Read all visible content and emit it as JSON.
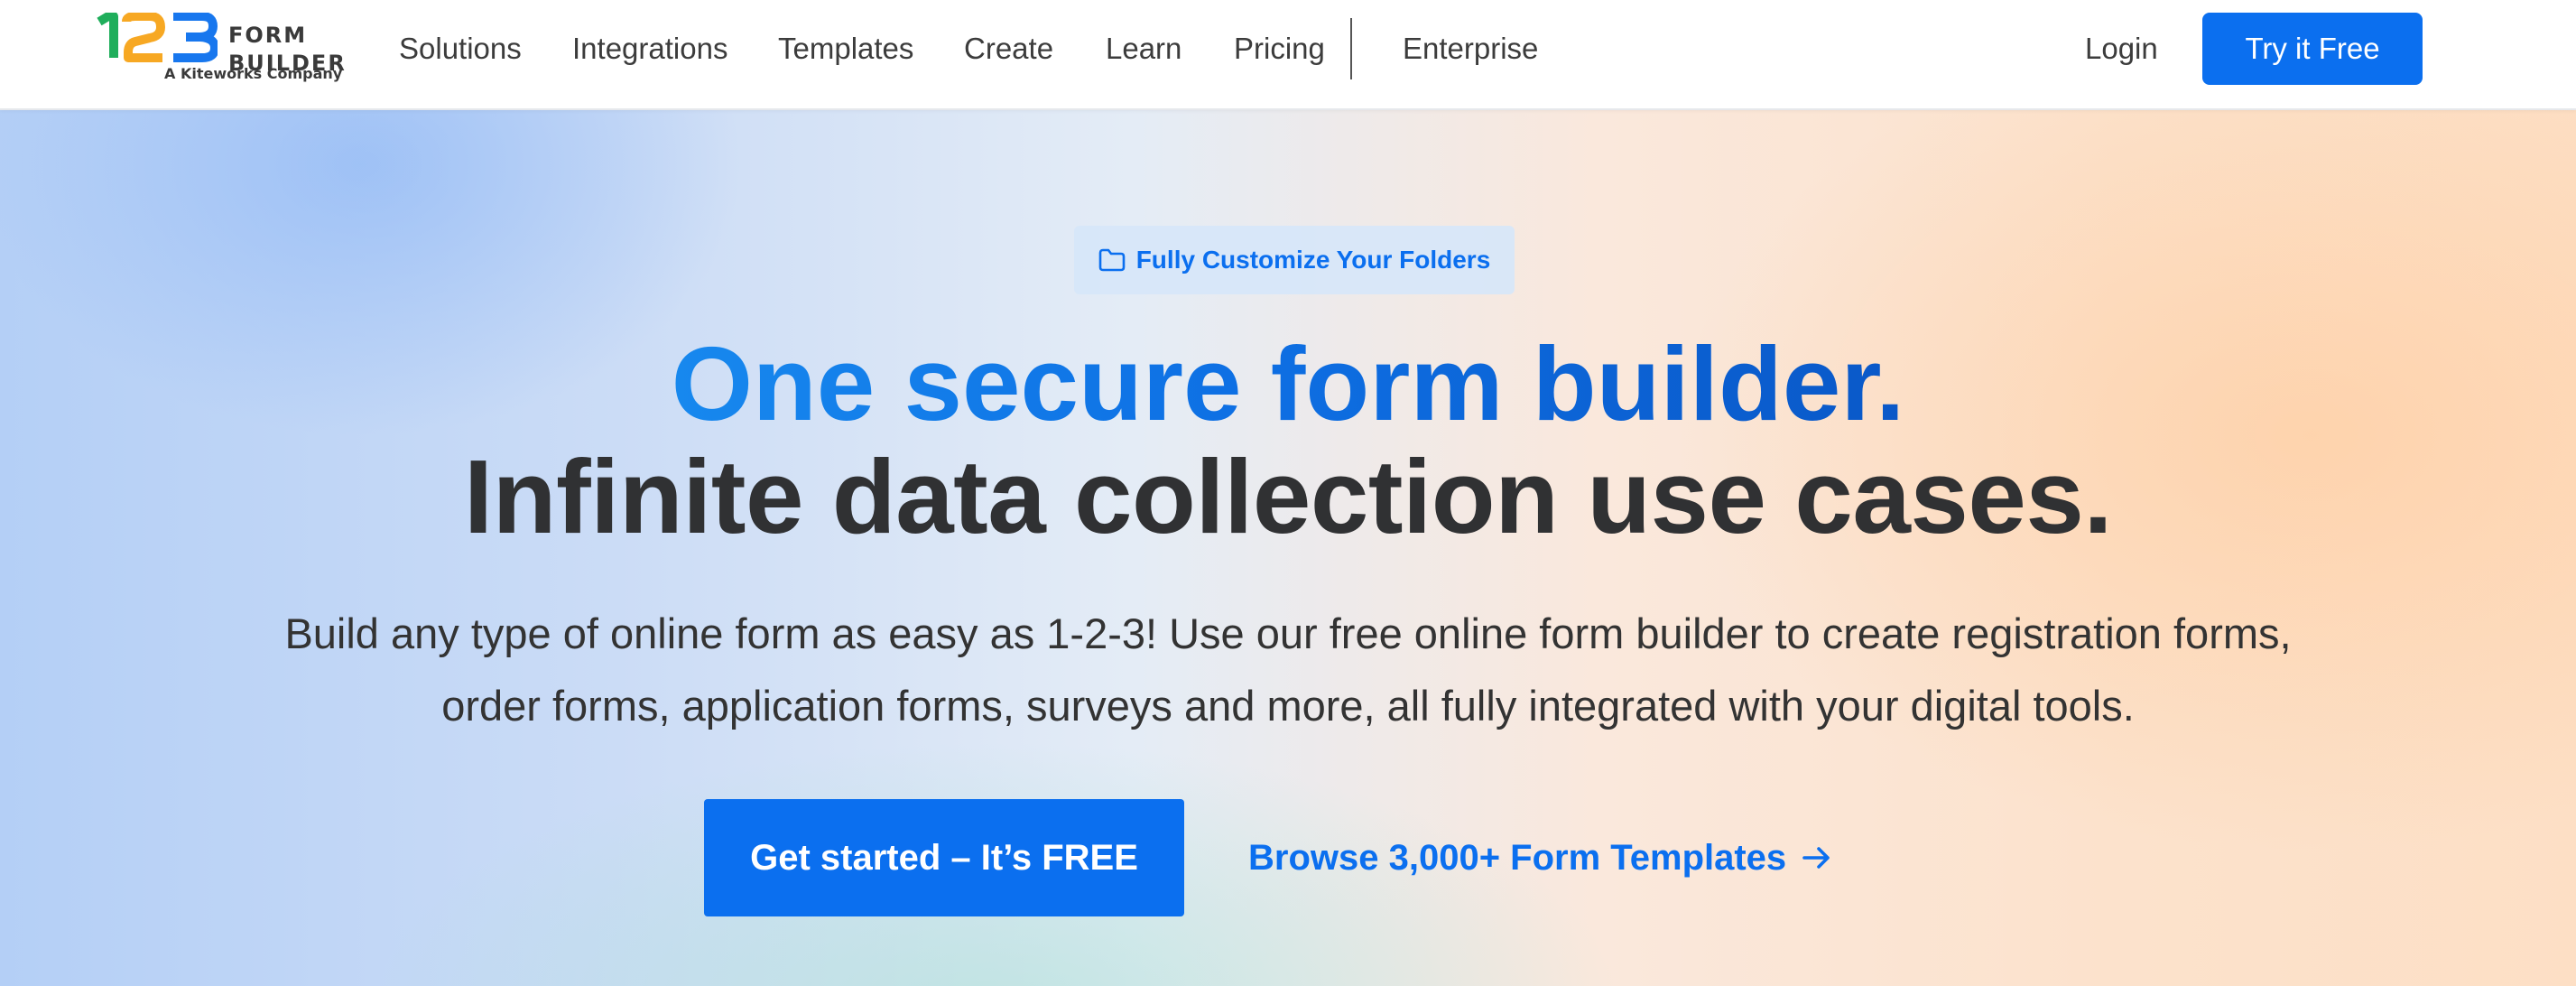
{
  "nav": {
    "logo": {
      "mark_text": "123",
      "word_line1": "FORM",
      "word_line2": "BUILDER",
      "tagline": "A Kiteworks Company"
    },
    "items": [
      {
        "label": "Solutions"
      },
      {
        "label": "Integrations"
      },
      {
        "label": "Templates"
      },
      {
        "label": "Create"
      },
      {
        "label": "Learn"
      },
      {
        "label": "Pricing"
      },
      {
        "label": "Enterprise"
      }
    ],
    "login_label": "Login",
    "try_free_label": "Try it Free"
  },
  "hero": {
    "badge": {
      "icon": "folder-icon",
      "label": "Fully Customize Your Folders"
    },
    "headline_line1": "One secure form builder.",
    "headline_line2": "Infinite data collection use cases.",
    "subtext_line1": "Build any type of online form as easy as 1-2-3! Use our free online form builder to create registration forms,",
    "subtext_line2": "order forms, application forms, surveys and more, all fully integrated with your digital tools.",
    "cta_label": "Get started – It’s FREE",
    "browse_label": "Browse 3,000+ Form Templates",
    "browse_icon": "arrow-right-icon"
  },
  "colors": {
    "brand_blue": "#0b6fef",
    "logo_green": "#1fae5b",
    "logo_orange": "#f7a823",
    "logo_blue": "#1877ee",
    "text_dark": "#303133"
  }
}
